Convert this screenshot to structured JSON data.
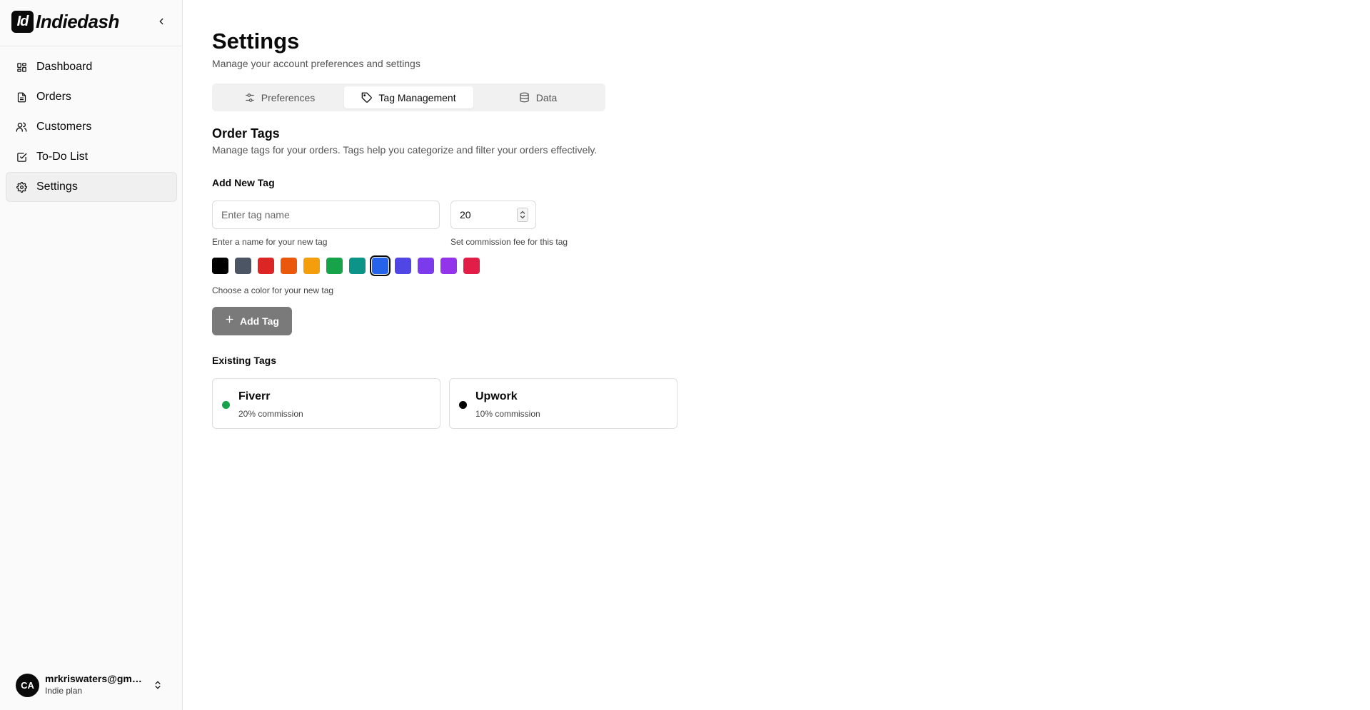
{
  "brand": {
    "mark": "Id",
    "name": "Indiedash"
  },
  "sidebar": {
    "items": [
      {
        "label": "Dashboard",
        "icon": "dashboard-icon"
      },
      {
        "label": "Orders",
        "icon": "file-icon"
      },
      {
        "label": "Customers",
        "icon": "users-icon"
      },
      {
        "label": "To-Do List",
        "icon": "checkbox-icon"
      },
      {
        "label": "Settings",
        "icon": "gear-icon"
      }
    ],
    "active": "Settings"
  },
  "user": {
    "initials": "CA",
    "email": "mrkriswaters@gmail.com",
    "plan": "Indie plan"
  },
  "header": {
    "title": "Settings",
    "subtitle": "Manage your account preferences and settings"
  },
  "tabs": [
    {
      "label": "Preferences",
      "icon": "sliders-icon"
    },
    {
      "label": "Tag Management",
      "icon": "tag-icon"
    },
    {
      "label": "Data",
      "icon": "database-icon"
    }
  ],
  "active_tab": "Tag Management",
  "order_tags": {
    "title": "Order Tags",
    "subtitle": "Manage tags for your orders. Tags help you categorize and filter your orders effectively."
  },
  "add_tag": {
    "label": "Add New Tag",
    "name_placeholder": "Enter tag name",
    "name_value": "",
    "name_help": "Enter a name for your new tag",
    "commission_value": "20",
    "commission_help": "Set commission fee for this tag",
    "color_help": "Choose a color for your new tag",
    "button_label": "Add Tag",
    "colors": [
      "#000000",
      "#4b5563",
      "#dc2626",
      "#ea580c",
      "#f59e0b",
      "#16a34a",
      "#0d9488",
      "#2563eb",
      "#4f46e5",
      "#7c3aed",
      "#9333ea",
      "#e11d48"
    ],
    "selected_color": "#2563eb"
  },
  "existing": {
    "label": "Existing Tags",
    "tags": [
      {
        "name": "Fiverr",
        "commission": "20% commission",
        "color": "#16a34a"
      },
      {
        "name": "Upwork",
        "commission": "10% commission",
        "color": "#000000"
      }
    ]
  }
}
